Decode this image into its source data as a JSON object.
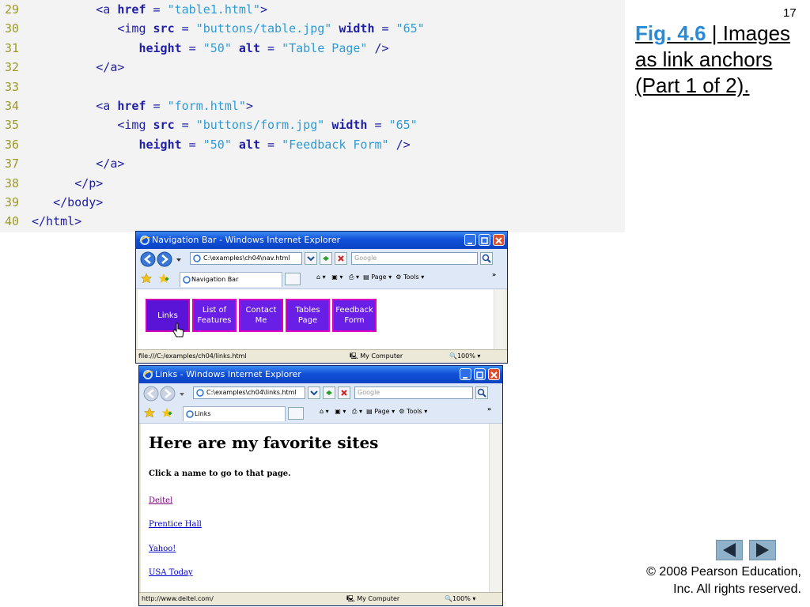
{
  "slide": {
    "page_number": "17",
    "fig_label": "Fig. 4.6",
    "fig_separator": " | ",
    "caption": "Images as link anchors (Part 1 of 2).",
    "copyright_line1": "© 2008 Pearson Education,",
    "copyright_line2": "Inc.  All rights reserved."
  },
  "code": {
    "lines": [
      {
        "num": "29",
        "indent": "         ",
        "tokens": [
          [
            "tag",
            "<a "
          ],
          [
            "attr",
            "href"
          ],
          [
            "tag",
            " = "
          ],
          [
            "val",
            "\"table1.html\""
          ],
          [
            "tag",
            ">"
          ]
        ]
      },
      {
        "num": "30",
        "indent": "            ",
        "tokens": [
          [
            "tag",
            "<img "
          ],
          [
            "attr",
            "src"
          ],
          [
            "tag",
            " = "
          ],
          [
            "val",
            "\"buttons/table.jpg\""
          ],
          [
            "tag",
            " "
          ],
          [
            "attr",
            "width"
          ],
          [
            "tag",
            " = "
          ],
          [
            "val",
            "\"65\""
          ]
        ]
      },
      {
        "num": "31",
        "indent": "               ",
        "tokens": [
          [
            "attr",
            "height"
          ],
          [
            "tag",
            " = "
          ],
          [
            "val",
            "\"50\""
          ],
          [
            "tag",
            " "
          ],
          [
            "attr",
            "alt"
          ],
          [
            "tag",
            " = "
          ],
          [
            "val",
            "\"Table Page\""
          ],
          [
            "tag",
            " />"
          ]
        ]
      },
      {
        "num": "32",
        "indent": "         ",
        "tokens": [
          [
            "tag",
            "</a>"
          ]
        ]
      },
      {
        "num": "33",
        "indent": "",
        "tokens": []
      },
      {
        "num": "34",
        "indent": "         ",
        "tokens": [
          [
            "tag",
            "<a "
          ],
          [
            "attr",
            "href"
          ],
          [
            "tag",
            " = "
          ],
          [
            "val",
            "\"form.html\""
          ],
          [
            "tag",
            ">"
          ]
        ]
      },
      {
        "num": "35",
        "indent": "            ",
        "tokens": [
          [
            "tag",
            "<img "
          ],
          [
            "attr",
            "src"
          ],
          [
            "tag",
            " = "
          ],
          [
            "val",
            "\"buttons/form.jpg\""
          ],
          [
            "tag",
            " "
          ],
          [
            "attr",
            "width"
          ],
          [
            "tag",
            " = "
          ],
          [
            "val",
            "\"65\""
          ]
        ]
      },
      {
        "num": "36",
        "indent": "               ",
        "tokens": [
          [
            "attr",
            "height"
          ],
          [
            "tag",
            " = "
          ],
          [
            "val",
            "\"50\""
          ],
          [
            "tag",
            " "
          ],
          [
            "attr",
            "alt"
          ],
          [
            "tag",
            " = "
          ],
          [
            "val",
            "\"Feedback Form\""
          ],
          [
            "tag",
            " />"
          ]
        ]
      },
      {
        "num": "37",
        "indent": "         ",
        "tokens": [
          [
            "tag",
            "</a>"
          ]
        ]
      },
      {
        "num": "38",
        "indent": "      ",
        "tokens": [
          [
            "tag",
            "</p>"
          ]
        ]
      },
      {
        "num": "39",
        "indent": "   ",
        "tokens": [
          [
            "tag",
            "</body>"
          ]
        ]
      },
      {
        "num": "40",
        "indent": "",
        "tokens": [
          [
            "tag",
            "</html>"
          ]
        ]
      }
    ]
  },
  "window1": {
    "title": "Navigation Bar - Windows Internet Explorer",
    "address": "C:\\examples\\ch04\\nav.html",
    "search_placeholder": "Google",
    "tab_label": "Navigation Bar",
    "page_menu": "Page",
    "tools_menu": "Tools",
    "nav_buttons": [
      "Links",
      "List of Features",
      "Contact Me",
      "Tables Page",
      "Feedback Form"
    ],
    "status_url": "file:///C:/examples/ch04/links.html",
    "zone": "My Computer",
    "zoom": "100%"
  },
  "window2": {
    "title": "Links - Windows Internet Explorer",
    "address": "C:\\examples\\ch04\\links.html",
    "search_placeholder": "Google",
    "tab_label": "Links",
    "page_menu": "Page",
    "tools_menu": "Tools",
    "heading": "Here are my favorite sites",
    "subheading": "Click a name to go to that page.",
    "links": [
      "Deitel",
      "Prentice Hall",
      "Yahoo!",
      "USA Today"
    ],
    "status_url": "http://www.deitel.com/",
    "zone": "My Computer",
    "zoom": "100%"
  },
  "colors": {
    "nav_button_fill": "#6a1fe6",
    "nav_button_border": "#e000c0",
    "visited_link": "#800080",
    "link": "#0000cc"
  },
  "icons": [
    "ie-icon",
    "back-icon",
    "forward-icon",
    "refresh-icon",
    "stop-icon",
    "search-icon",
    "favorites-star-icon",
    "add-favorites-icon",
    "home-icon",
    "feeds-icon",
    "print-icon",
    "page-icon",
    "tools-gear-icon",
    "minimize-icon",
    "maximize-icon",
    "close-icon",
    "hand-cursor-icon",
    "computer-icon",
    "zoom-icon",
    "prev-slide-icon",
    "next-slide-icon"
  ]
}
